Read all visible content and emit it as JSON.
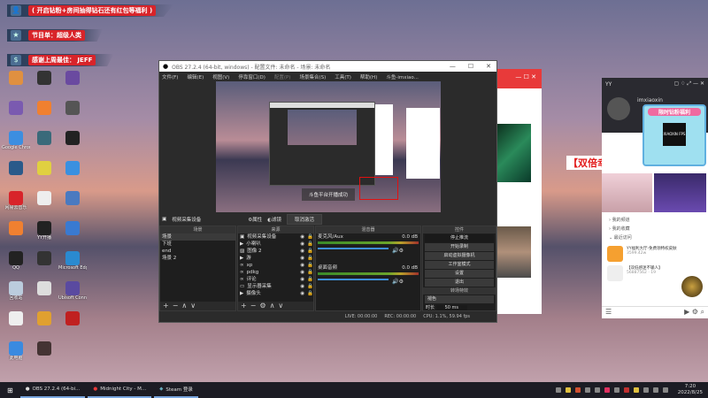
{
  "overlay": {
    "banners": [
      {
        "icon": "person-icon",
        "text": "( 开启钻粉+房间抽得钻石还有红包等福利 )"
      },
      {
        "icon": "star-icon",
        "text": "节目单：超级人类"
      },
      {
        "icon": "dollar-icon",
        "text": "感谢上周最佳： JEFF"
      }
    ]
  },
  "desktop": {
    "icons": [
      {
        "label": "",
        "color": "#e09040"
      },
      {
        "label": "",
        "color": "#333"
      },
      {
        "label": "",
        "color": "#6a4aa0"
      },
      {
        "label": "",
        "color": "#7a5ab0"
      },
      {
        "label": "",
        "color": "#f08030"
      },
      {
        "label": "",
        "color": "#555"
      },
      {
        "label": "Google Chrome",
        "color": "#3c8ee0"
      },
      {
        "label": "",
        "color": "#3a6a7a"
      },
      {
        "label": "",
        "color": "#222"
      },
      {
        "label": "",
        "color": "#2a5a8a"
      },
      {
        "label": "",
        "color": "#e0d040"
      },
      {
        "label": "",
        "color": "#3a90e0"
      },
      {
        "label": "网易云音乐",
        "color": "#d8242a"
      },
      {
        "label": "",
        "color": "#eee"
      },
      {
        "label": "",
        "color": "#4a7ac0"
      },
      {
        "label": "",
        "color": "#f08030"
      },
      {
        "label": "YY开播",
        "color": "#222"
      },
      {
        "label": "",
        "color": "#3a7ad0"
      },
      {
        "label": "QQ",
        "color": "#222"
      },
      {
        "label": "",
        "color": "#333"
      },
      {
        "label": "Microsoft Edge",
        "color": "#2a8ad0"
      },
      {
        "label": "回收站",
        "color": "#bcd"
      },
      {
        "label": "",
        "color": "#ddd"
      },
      {
        "label": "Ubisoft Connect",
        "color": "#5a4aa0"
      },
      {
        "label": "",
        "color": "#eee"
      },
      {
        "label": "",
        "color": "#e0a030"
      },
      {
        "label": "",
        "color": "#c02020"
      },
      {
        "label": "此电脑",
        "color": "#3a8ae0"
      },
      {
        "label": "",
        "color": "#433"
      }
    ]
  },
  "obs": {
    "title": "OBS 27.2.4 (64-bit, windows) - 配置文件: 未命名 - 场景: 未命名",
    "menu": [
      "文件(F)",
      "编辑(E)",
      "视图(V)",
      "停靠窗口(D)",
      "配置(P)",
      "场景集合(S)",
      "工具(T)",
      "帮助(H)",
      "斗鱼-imxiao..."
    ],
    "preview_toast": "斗鱼平台开播成功",
    "source_bar": {
      "selected": "视频采集设备",
      "properties": "属性",
      "filters": "滤镜",
      "deactivate": "取消激活"
    },
    "scenes": {
      "header": "场景",
      "items": [
        "场景",
        "下班",
        "end",
        "场景 2"
      ]
    },
    "sources": {
      "header": "来源",
      "items": [
        "视频采集设备",
        "小喇叭",
        "图像 2",
        "游",
        "xp",
        "pdkg",
        "评论",
        "显示器采集",
        "摄像头"
      ]
    },
    "mixer": {
      "header": "混音器",
      "tracks": [
        {
          "name": "麦克风/Aux",
          "db": "0.0 dB",
          "level": 0.8
        },
        {
          "name": "桌面音频",
          "db": "0.0 dB",
          "level": 0.8
        }
      ]
    },
    "controls": {
      "header": "控件",
      "buttons": [
        "停止推流",
        "开始录制",
        "启动虚拟摄像机",
        "工作室模式",
        "设置",
        "退出"
      ]
    },
    "transitions": {
      "header": "转场特效",
      "type": "褪色",
      "duration_label": "时长",
      "duration": "50 ms"
    },
    "status": {
      "live": "LIVE: 00:00:00",
      "rec": "REC: 00:00:00",
      "cpu": "CPU: 1.1%, 59.94 fps"
    }
  },
  "right": {
    "banner": "【双倍幸运日】",
    "yy": {
      "app": "YY",
      "user": "imxiaoxin",
      "promo": "限时钻粉福利",
      "logo": "XIAOXIN FPS",
      "menu": [
        "我的频道",
        "我的收藏",
        "最近访问"
      ],
      "recent": [
        {
          "name": "YY福利大厅-免费领特权皮肤",
          "count": "3599.42w"
        },
        {
          "name": "【双低感迷不输人】",
          "count": "56887562",
          "extra": "19"
        }
      ]
    }
  },
  "taskbar": {
    "items": [
      {
        "label": "OBS 27.2.4 (64-bi..."
      },
      {
        "label": "Midnight City - M..."
      },
      {
        "label": "Steam 登录"
      }
    ],
    "time": "7:20",
    "date": "2022/8/25"
  }
}
